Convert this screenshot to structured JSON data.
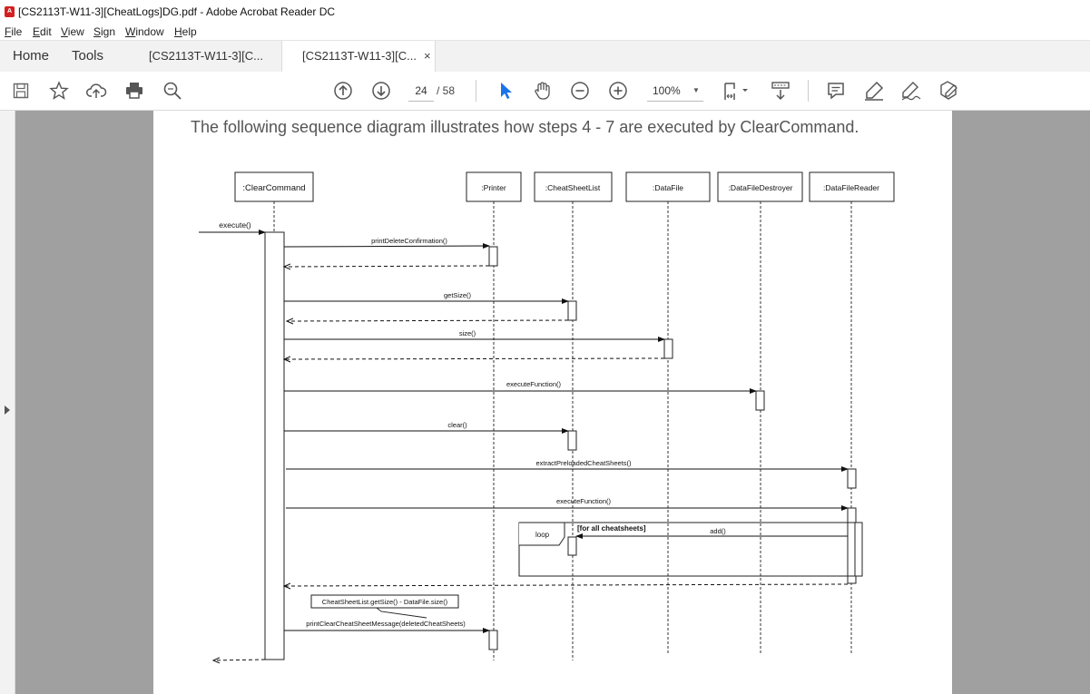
{
  "window": {
    "title": "[CS2113T-W11-3][CheatLogs]DG.pdf - Adobe Acrobat Reader DC",
    "app_icon": "pdf-icon"
  },
  "menu": [
    "File",
    "Edit",
    "View",
    "Sign",
    "Window",
    "Help"
  ],
  "tabs": {
    "home": "Home",
    "tools": "Tools",
    "doc1": "[CS2113T-W11-3][C...",
    "doc2": "[CS2113T-W11-3][C...",
    "close": "×"
  },
  "toolbar": {
    "page_current": "24",
    "page_total": "/ 58",
    "zoom": "100%"
  },
  "document": {
    "caption": "The following sequence diagram illustrates how steps 4 - 7 are executed by ClearCommand.",
    "diagram": {
      "participants": [
        ":ClearCommand",
        ":Printer",
        ":CheatSheetList",
        ":DataFile",
        ":DataFileDestroyer",
        ":DataFileReader"
      ],
      "messages": {
        "m_execute": "execute()",
        "m_print_delete": "printDeleteConfirmation()",
        "m_getsize": "getSize()",
        "m_size": "size()",
        "m_execfn1": "executeFunction()",
        "m_clear": "clear()",
        "m_extract": "extractPreloadedCheatSheets()",
        "m_execfn2": "executeFunction()",
        "m_add": "add()",
        "m_print_clear": "printClearCheatSheetMessage(deletedCheatSheets)"
      },
      "loop_label": "loop",
      "loop_guard": "[for all cheatsheets]",
      "note": "CheatSheetList.getSize() - DataFile.size()"
    }
  },
  "colors": {
    "accent": "#1a73e8",
    "workspace": "#a0a0a0",
    "pdf_red": "#d32020"
  }
}
